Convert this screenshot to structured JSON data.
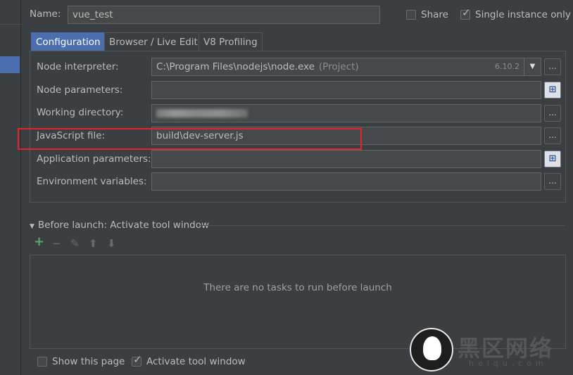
{
  "name_row": {
    "label": "Name:",
    "value": "vue_test",
    "share_label": "Share",
    "share_checked": false,
    "single_instance_label": "Single instance only",
    "single_instance_checked": true
  },
  "tabs": [
    {
      "label": "Configuration",
      "active": true
    },
    {
      "label": "Browser / Live Edit",
      "active": false
    },
    {
      "label": "V8 Profiling",
      "active": false
    }
  ],
  "config": {
    "node_interpreter": {
      "label": "Node interpreter:",
      "value": "C:\\Program Files\\nodejs\\node.exe",
      "note": "(Project)",
      "version": "6.10.2"
    },
    "node_parameters": {
      "label": "Node parameters:",
      "value": ""
    },
    "working_directory": {
      "label": "Working directory:",
      "value": ""
    },
    "javascript_file": {
      "label": "JavaScript file:",
      "value": "build\\dev-server.js"
    },
    "application_parameters": {
      "label": "Application parameters:",
      "value": ""
    },
    "environment_variables": {
      "label": "Environment variables:",
      "value": ""
    },
    "browse_label": "..."
  },
  "before_launch": {
    "title": "Before launch: Activate tool window",
    "empty_text": "There are no tasks to run before launch",
    "tools": {
      "add": "+",
      "remove": "−",
      "edit": "✎",
      "up": "⬆",
      "down": "⬇"
    }
  },
  "footer": {
    "show_page_label": "Show this page",
    "show_page_checked": false,
    "activate_tool_label": "Activate tool window",
    "activate_tool_checked": true
  },
  "icons": {
    "dropdown": "chevron-down-icon",
    "expand": "expand-icon"
  },
  "colors": {
    "background": "#3c3f41",
    "accent": "#4b6eaf",
    "highlight": "#e0262c",
    "add": "#59a869"
  },
  "watermark": {
    "text": "黑区网络",
    "sub": "heiqu.com"
  }
}
